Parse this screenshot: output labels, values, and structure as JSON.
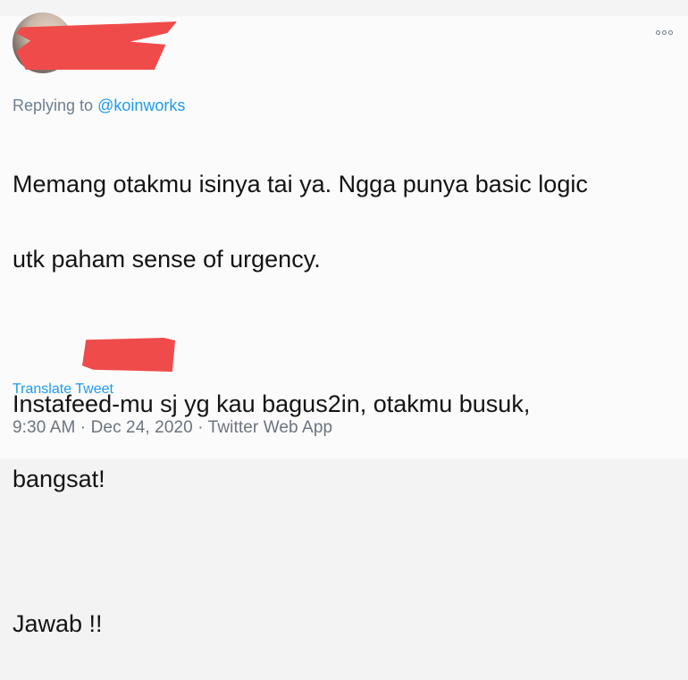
{
  "tweet": {
    "replying_to_prefix": "Replying to ",
    "replying_to_handle": "@koinworks",
    "lines": [
      "Memang otakmu isinya tai ya. Ngga punya basic logic",
      "utk paham sense of urgency.",
      "Instafeed-mu sj yg kau bagus2in, otakmu busuk,",
      "bangsat!",
      "Jawab !!"
    ],
    "translate_label": "Translate Tweet",
    "timestamp": "9:30 AM · Dec 24, 2020 · Twitter Web App"
  },
  "icons": {
    "menu": "more-options-icon"
  },
  "colors": {
    "link": "#1d9bf0",
    "redaction": "#f04b4b",
    "text": "#141414",
    "muted": "#6c7480"
  }
}
